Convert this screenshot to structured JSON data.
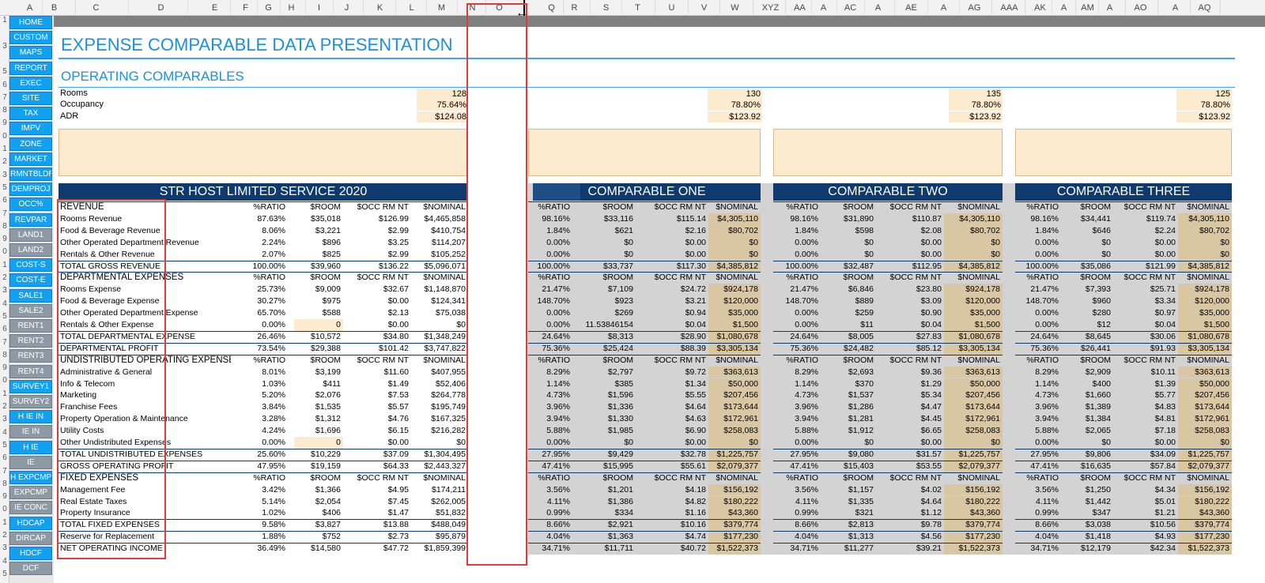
{
  "column_headers": [
    "A",
    "B",
    "C",
    "D",
    "E",
    "F",
    "G",
    "H",
    "I",
    "J",
    "K",
    "L",
    "M",
    "N",
    "O",
    "Q",
    "R",
    "S",
    "T",
    "U",
    "V",
    "W",
    "XYZ",
    "AA",
    "A",
    "AC",
    "A",
    "AE",
    "A",
    "AG",
    "AAA",
    "AK",
    "A",
    "AM",
    "A",
    "AO",
    "A",
    "AQ"
  ],
  "row_numbers": [
    "1",
    "",
    "3",
    "",
    "5",
    "6",
    "7",
    "8",
    "9",
    "0",
    "1",
    "2",
    "3",
    "5",
    "6",
    "7",
    "8",
    "9",
    "0",
    "1",
    "2",
    "3",
    "4",
    "5",
    "6",
    "7",
    "8",
    "9",
    "0",
    "1",
    "2",
    "3",
    "4",
    "5",
    "6",
    "7",
    "8",
    "9",
    "0",
    "1",
    "2",
    "3",
    "4",
    "5"
  ],
  "nav_buttons": [
    {
      "label": "HOME",
      "style": "blue"
    },
    {
      "label": "CUSTOM",
      "style": "blue"
    },
    {
      "label": "MAPS",
      "style": "blue"
    },
    {
      "label": "REPORT",
      "style": "blue"
    },
    {
      "label": "EXEC",
      "style": "blue"
    },
    {
      "label": "SITE",
      "style": "blue"
    },
    {
      "label": "TAX",
      "style": "blue"
    },
    {
      "label": "IMPV",
      "style": "blue"
    },
    {
      "label": "ZONE",
      "style": "blue"
    },
    {
      "label": "MARKET",
      "style": "blue"
    },
    {
      "label": "RMNTBLDR",
      "style": "blue"
    },
    {
      "label": "DEMPROJ",
      "style": "blue"
    },
    {
      "label": "OCC%",
      "style": "blue"
    },
    {
      "label": "REVPAR",
      "style": "blue"
    },
    {
      "label": "LAND1",
      "style": "gray"
    },
    {
      "label": "LAND2",
      "style": "gray"
    },
    {
      "label": "COST-S",
      "style": "blue"
    },
    {
      "label": "COST-E",
      "style": "blue"
    },
    {
      "label": "SALE1",
      "style": "blue"
    },
    {
      "label": "SALE2",
      "style": "gray"
    },
    {
      "label": "RENT1",
      "style": "gray"
    },
    {
      "label": "RENT2",
      "style": "gray"
    },
    {
      "label": "RENT3",
      "style": "gray"
    },
    {
      "label": "RENT4",
      "style": "gray"
    },
    {
      "label": "SURVEY1",
      "style": "blue"
    },
    {
      "label": "SURVEY2",
      "style": "gray"
    },
    {
      "label": "H IE IN",
      "style": "blue"
    },
    {
      "label": "IE IN",
      "style": "gray"
    },
    {
      "label": "H IE",
      "style": "blue"
    },
    {
      "label": "IE",
      "style": "gray"
    },
    {
      "label": "H EXPCMP",
      "style": "blue"
    },
    {
      "label": "EXPCMP",
      "style": "gray"
    },
    {
      "label": "IE CONC",
      "style": "gray"
    },
    {
      "label": "HDCAP",
      "style": "blue"
    },
    {
      "label": "DIRCAP",
      "style": "gray"
    },
    {
      "label": "HDCF",
      "style": "blue"
    },
    {
      "label": "DCF",
      "style": "gray"
    }
  ],
  "title": "EXPENSE COMPARABLE DATA PRESENTATION",
  "subtitle": "OPERATING COMPARABLES",
  "op_labels": [
    "Rooms",
    "Occupancy",
    "ADR"
  ],
  "op_values": [
    [
      "128",
      "75.64%",
      "$124.08"
    ],
    [
      "130",
      "78.80%",
      "$123.92"
    ],
    [
      "135",
      "78.80%",
      "$123.92"
    ],
    [
      "125",
      "78.80%",
      "$123.92"
    ]
  ],
  "subject_header": "STR HOST LIMITED SERVICE 2020",
  "comp_headers": [
    "COMPARABLE ONE",
    "COMPARABLE TWO",
    "COMPARABLE THREE"
  ],
  "col_heads": [
    "%RATIO",
    "$ROOM",
    "$OCC RM NT",
    "$NOMINAL"
  ],
  "rows": [
    {
      "label": "REVENUE",
      "type": "section",
      "s": [
        "%RATIO",
        "$ROOM",
        "$OCC RM NT",
        "$NOMINAL"
      ],
      "c1": [
        "%RATIO",
        "$ROOM",
        "$OCC RM NT",
        "$NOMINAL"
      ],
      "c2": [
        "%RATIO",
        "$ROOM",
        "$OCC RM NT",
        "$NOMINAL"
      ],
      "c3": [
        "%RATIO",
        "$ROOM",
        "$OCC RM NT",
        "$NOMINAL"
      ]
    },
    {
      "label": "Rooms Revenue",
      "type": "item",
      "s": [
        "87.63%",
        "$35,018",
        "$126.99",
        "$4,465,858"
      ],
      "c1": [
        "98.16%",
        "$33,116",
        "$115.14",
        "$4,305,110"
      ],
      "c2": [
        "98.16%",
        "$31,890",
        "$110.87",
        "$4,305,110"
      ],
      "c3": [
        "98.16%",
        "$34,441",
        "$119.74",
        "$4,305,110"
      ]
    },
    {
      "label": "Food & Beverage Revenue",
      "type": "item",
      "s": [
        "8.06%",
        "$3,221",
        "$2.99",
        "$410,754"
      ],
      "c1": [
        "1.84%",
        "$621",
        "$2.16",
        "$80,702"
      ],
      "c2": [
        "1.84%",
        "$598",
        "$2.08",
        "$80,702"
      ],
      "c3": [
        "1.84%",
        "$646",
        "$2.24",
        "$80,702"
      ]
    },
    {
      "label": "Other Operated Department Revenue",
      "type": "item",
      "s": [
        "2.24%",
        "$896",
        "$3.25",
        "$114,207"
      ],
      "c1": [
        "0.00%",
        "$0",
        "$0.00",
        "$0"
      ],
      "c2": [
        "0.00%",
        "$0",
        "$0.00",
        "$0"
      ],
      "c3": [
        "0.00%",
        "$0",
        "$0.00",
        "$0"
      ]
    },
    {
      "label": "Rentals & Other Revenue",
      "type": "item",
      "s": [
        "2.07%",
        "$825",
        "$2.99",
        "$105,252"
      ],
      "c1": [
        "0.00%",
        "$0",
        "$0.00",
        "$0"
      ],
      "c2": [
        "0.00%",
        "$0",
        "$0.00",
        "$0"
      ],
      "c3": [
        "0.00%",
        "$0",
        "$0.00",
        "$0"
      ]
    },
    {
      "label": "TOTAL GROSS REVENUE",
      "type": "total",
      "s": [
        "100.00%",
        "$39,960",
        "$136.22",
        "$5,096,071"
      ],
      "c1": [
        "100.00%",
        "$33,737",
        "$117.30",
        "$4,385,812"
      ],
      "c2": [
        "100.00%",
        "$32,487",
        "$112.95",
        "$4,385,812"
      ],
      "c3": [
        "100.00%",
        "$35,086",
        "$121.99",
        "$4,385,812"
      ]
    },
    {
      "label": "DEPARTMENTAL EXPENSES",
      "type": "section",
      "s": [
        "%RATIO",
        "$ROOM",
        "$OCC RM NT",
        "$NOMINAL"
      ],
      "c1": [
        "%RATIO",
        "$ROOM",
        "$OCC RM NT",
        "$NOMINAL"
      ],
      "c2": [
        "%RATIO",
        "$ROOM",
        "$OCC RM NT",
        "$NOMINAL"
      ],
      "c3": [
        "%RATIO",
        "$ROOM",
        "$OCC RM NT",
        "$NOMINAL"
      ]
    },
    {
      "label": "Rooms Expense",
      "type": "item",
      "s": [
        "25.73%",
        "$9,009",
        "$32.67",
        "$1,148,870"
      ],
      "c1": [
        "21.47%",
        "$7,109",
        "$24.72",
        "$924,178"
      ],
      "c2": [
        "21.47%",
        "$6,846",
        "$23.80",
        "$924,178"
      ],
      "c3": [
        "21.47%",
        "$7,393",
        "$25.71",
        "$924,178"
      ]
    },
    {
      "label": "Food & Beverage Expense",
      "type": "item",
      "s": [
        "30.27%",
        "$975",
        "$0.00",
        "$124,341"
      ],
      "c1": [
        "148.70%",
        "$923",
        "$3.21",
        "$120,000"
      ],
      "c2": [
        "148.70%",
        "$889",
        "$3.09",
        "$120,000"
      ],
      "c3": [
        "148.70%",
        "$960",
        "$3.34",
        "$120,000"
      ]
    },
    {
      "label": "Other Operated Department Expense",
      "type": "item",
      "s": [
        "65.70%",
        "$588",
        "$2.13",
        "$75,038"
      ],
      "c1": [
        "0.00%",
        "$269",
        "$0.94",
        "$35,000"
      ],
      "c2": [
        "0.00%",
        "$259",
        "$0.90",
        "$35,000"
      ],
      "c3": [
        "0.00%",
        "$280",
        "$0.97",
        "$35,000"
      ]
    },
    {
      "label": "Rentals & Other Expense",
      "type": "item",
      "s": [
        "0.00%",
        "0",
        "$0.00",
        "$0"
      ],
      "c1": [
        "0.00%",
        "11.53846154",
        "$0.04",
        "$1,500"
      ],
      "c2": [
        "0.00%",
        "$11",
        "$0.04",
        "$1,500"
      ],
      "c3": [
        "0.00%",
        "$12",
        "$0.04",
        "$1,500"
      ]
    },
    {
      "label": "TOTAL DEPARTMENTAL EXPENSE",
      "type": "total",
      "s": [
        "26.46%",
        "$10,572",
        "$34.80",
        "$1,348,249"
      ],
      "c1": [
        "24.64%",
        "$8,313",
        "$28.90",
        "$1,080,678"
      ],
      "c2": [
        "24.64%",
        "$8,005",
        "$27.83",
        "$1,080,678"
      ],
      "c3": [
        "24.64%",
        "$8,645",
        "$30.06",
        "$1,080,678"
      ]
    },
    {
      "label": "DEPARTMENTAL PROFIT",
      "type": "total",
      "s": [
        "73.54%",
        "$29,388",
        "$101.42",
        "$3,747,822"
      ],
      "c1": [
        "75.36%",
        "$25,424",
        "$88.39",
        "$3,305,134"
      ],
      "c2": [
        "75.36%",
        "$24,482",
        "$85.12",
        "$3,305,134"
      ],
      "c3": [
        "75.36%",
        "$26,441",
        "$91.93",
        "$3,305,134"
      ]
    },
    {
      "label": "UNDISTRIBUTED OPERATING EXPENSES",
      "type": "section",
      "s": [
        "%RATIO",
        "$ROOM",
        "$OCC RM NT",
        "$NOMINAL"
      ],
      "c1": [
        "%RATIO",
        "$ROOM",
        "$OCC RM NT",
        "$NOMINAL"
      ],
      "c2": [
        "%RATIO",
        "$ROOM",
        "$OCC RM NT",
        "$NOMINAL"
      ],
      "c3": [
        "%RATIO",
        "$ROOM",
        "$OCC RM NT",
        "$NOMINAL"
      ]
    },
    {
      "label": "Administrative & General",
      "type": "item",
      "s": [
        "8.01%",
        "$3,199",
        "$11.60",
        "$407,955"
      ],
      "c1": [
        "8.29%",
        "$2,797",
        "$9.72",
        "$363,613"
      ],
      "c2": [
        "8.29%",
        "$2,693",
        "$9.36",
        "$363,613"
      ],
      "c3": [
        "8.29%",
        "$2,909",
        "$10.11",
        "$363,613"
      ]
    },
    {
      "label": "Info & Telecom",
      "type": "item",
      "s": [
        "1.03%",
        "$411",
        "$1.49",
        "$52,406"
      ],
      "c1": [
        "1.14%",
        "$385",
        "$1.34",
        "$50,000"
      ],
      "c2": [
        "1.14%",
        "$370",
        "$1.29",
        "$50,000"
      ],
      "c3": [
        "1.14%",
        "$400",
        "$1.39",
        "$50,000"
      ]
    },
    {
      "label": "Marketing",
      "type": "item",
      "s": [
        "5.20%",
        "$2,076",
        "$7.53",
        "$264,778"
      ],
      "c1": [
        "4.73%",
        "$1,596",
        "$5.55",
        "$207,456"
      ],
      "c2": [
        "4.73%",
        "$1,537",
        "$5.34",
        "$207,456"
      ],
      "c3": [
        "4.73%",
        "$1,660",
        "$5.77",
        "$207,456"
      ]
    },
    {
      "label": "Franchise Fees",
      "type": "item",
      "s": [
        "3.84%",
        "$1,535",
        "$5.57",
        "$195,749"
      ],
      "c1": [
        "3.96%",
        "$1,336",
        "$4.64",
        "$173,644"
      ],
      "c2": [
        "3.96%",
        "$1,286",
        "$4.47",
        "$173,644"
      ],
      "c3": [
        "3.96%",
        "$1,389",
        "$4.83",
        "$173,644"
      ]
    },
    {
      "label": "Property Operation & Maintenance",
      "type": "item",
      "s": [
        "3.28%",
        "$1,312",
        "$4.76",
        "$167,325"
      ],
      "c1": [
        "3.94%",
        "$1,330",
        "$4.63",
        "$172,961"
      ],
      "c2": [
        "3.94%",
        "$1,281",
        "$4.45",
        "$172,961"
      ],
      "c3": [
        "3.94%",
        "$1,384",
        "$4.81",
        "$172,961"
      ]
    },
    {
      "label": "Utility Costs",
      "type": "item",
      "s": [
        "4.24%",
        "$1,696",
        "$6.15",
        "$216,282"
      ],
      "c1": [
        "5.88%",
        "$1,985",
        "$6.90",
        "$258,083"
      ],
      "c2": [
        "5.88%",
        "$1,912",
        "$6.65",
        "$258,083"
      ],
      "c3": [
        "5.88%",
        "$2,065",
        "$7.18",
        "$258,083"
      ]
    },
    {
      "label": "Other Undistributed Expenses",
      "type": "item",
      "s": [
        "0.00%",
        "0",
        "$0.00",
        "$0"
      ],
      "c1": [
        "0.00%",
        "$0",
        "$0.00",
        "$0"
      ],
      "c2": [
        "0.00%",
        "$0",
        "$0.00",
        "$0"
      ],
      "c3": [
        "0.00%",
        "$0",
        "$0.00",
        "$0"
      ]
    },
    {
      "label": "TOTAL UNDISTRIBUTED EXPENSES",
      "type": "total",
      "s": [
        "25.60%",
        "$10,229",
        "$37.09",
        "$1,304,495"
      ],
      "c1": [
        "27.95%",
        "$9,429",
        "$32.78",
        "$1,225,757"
      ],
      "c2": [
        "27.95%",
        "$9,080",
        "$31.57",
        "$1,225,757"
      ],
      "c3": [
        "27.95%",
        "$9,806",
        "$34.09",
        "$1,225,757"
      ]
    },
    {
      "label": "GROSS OPERATING PROFIT",
      "type": "total",
      "s": [
        "47.95%",
        "$19,159",
        "$64.33",
        "$2,443,327"
      ],
      "c1": [
        "47.41%",
        "$15,995",
        "$55.61",
        "$2,079,377"
      ],
      "c2": [
        "47.41%",
        "$15,403",
        "$53.55",
        "$2,079,377"
      ],
      "c3": [
        "47.41%",
        "$16,635",
        "$57.84",
        "$2,079,377"
      ]
    },
    {
      "label": "FIXED EXPENSES",
      "type": "section",
      "s": [
        "%RATIO",
        "$ROOM",
        "$OCC RM NT",
        "$NOMINAL"
      ],
      "c1": [
        "%RATIO",
        "$ROOM",
        "$OCC RM NT",
        "$NOMINAL"
      ],
      "c2": [
        "%RATIO",
        "$ROOM",
        "$OCC RM NT",
        "$NOMINAL"
      ],
      "c3": [
        "%RATIO",
        "$ROOM",
        "$OCC RM NT",
        "$NOMINAL"
      ]
    },
    {
      "label": "Management Fee",
      "type": "item",
      "s": [
        "3.42%",
        "$1,366",
        "$4.95",
        "$174,211"
      ],
      "c1": [
        "3.56%",
        "$1,201",
        "$4.18",
        "$156,192"
      ],
      "c2": [
        "3.56%",
        "$1,157",
        "$4.02",
        "$156,192"
      ],
      "c3": [
        "3.56%",
        "$1,250",
        "$4.34",
        "$156,192"
      ]
    },
    {
      "label": "Real Estate Taxes",
      "type": "item",
      "s": [
        "5.14%",
        "$2,054",
        "$7.45",
        "$262,005"
      ],
      "c1": [
        "4.11%",
        "$1,386",
        "$4.82",
        "$180,222"
      ],
      "c2": [
        "4.11%",
        "$1,335",
        "$4.64",
        "$180,222"
      ],
      "c3": [
        "4.11%",
        "$1,442",
        "$5.01",
        "$180,222"
      ]
    },
    {
      "label": "Property Insurance",
      "type": "item",
      "s": [
        "1.02%",
        "$406",
        "$1.47",
        "$51,832"
      ],
      "c1": [
        "0.99%",
        "$334",
        "$1.16",
        "$43,360"
      ],
      "c2": [
        "0.99%",
        "$321",
        "$1.12",
        "$43,360"
      ],
      "c3": [
        "0.99%",
        "$347",
        "$1.21",
        "$43,360"
      ]
    },
    {
      "label": "TOTAL FIXED EXPENSES",
      "type": "total",
      "s": [
        "9.58%",
        "$3,827",
        "$13.88",
        "$488,049"
      ],
      "c1": [
        "8.66%",
        "$2,921",
        "$10.16",
        "$379,774"
      ],
      "c2": [
        "8.66%",
        "$2,813",
        "$9.78",
        "$379,774"
      ],
      "c3": [
        "8.66%",
        "$3,038",
        "$10.56",
        "$379,774"
      ]
    },
    {
      "label": "Reserve for Replacement",
      "type": "total",
      "s": [
        "1.88%",
        "$752",
        "$2.73",
        "$95,879"
      ],
      "c1": [
        "4.04%",
        "$1,363",
        "$4.74",
        "$177,230"
      ],
      "c2": [
        "4.04%",
        "$1,313",
        "$4.56",
        "$177,230"
      ],
      "c3": [
        "4.04%",
        "$1,418",
        "$4.93",
        "$177,230"
      ]
    },
    {
      "label": "NET OPERATING INCOME",
      "type": "total",
      "s": [
        "36.49%",
        "$14,580",
        "$47.72",
        "$1,859,399"
      ],
      "c1": [
        "34.71%",
        "$11,711",
        "$40.72",
        "$1,522,373"
      ],
      "c2": [
        "34.71%",
        "$11,277",
        "$39.21",
        "$1,522,373"
      ],
      "c3": [
        "34.71%",
        "$12,179",
        "$42.34",
        "$1,522,373"
      ]
    }
  ],
  "colors": {
    "accent_blue": "#1e90d8",
    "header_navy": "#0f3a6e",
    "input_beige": "#fdebd0",
    "tan": "#d9c7a4",
    "panel_gray": "#d3d3d3",
    "highlight_red": "#e03b3b",
    "nav_blue": "#12a0f0",
    "nav_gray": "#8d9aa6"
  },
  "icons": {
    "resize_cursor": "col-resize-icon"
  }
}
